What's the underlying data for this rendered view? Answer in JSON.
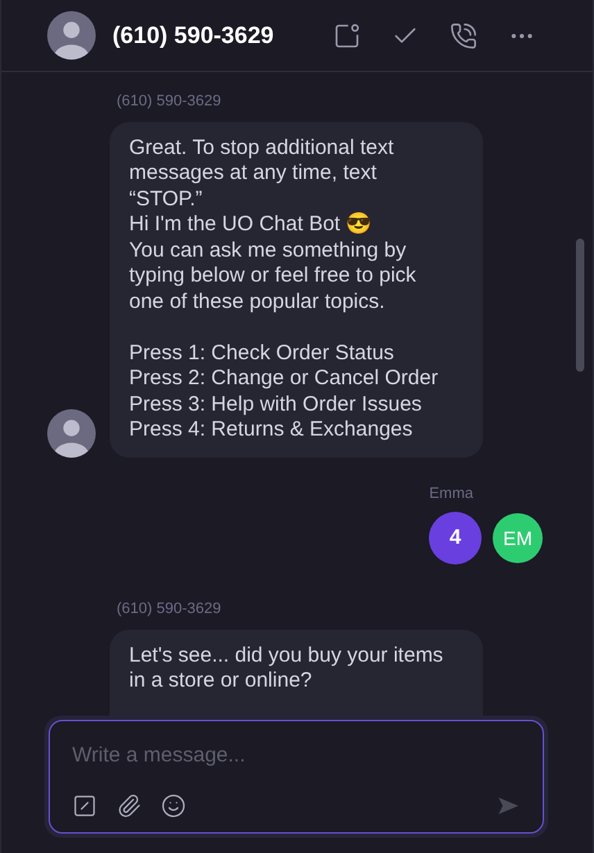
{
  "header": {
    "title": "(610) 590-3629"
  },
  "messages": [
    {
      "kind": "incoming",
      "sender": "(610) 590-3629",
      "text": "Great. To stop additional text messages at any time, text “STOP.”\nHi I'm the UO Chat Bot 😎\nYou can ask me something by typing below or feel free to pick one of these popular topics.\n\nPress 1: Check Order Status\nPress 2: Change or Cancel Order\nPress 3: Help with Order Issues\nPress 4: Returns & Exchanges",
      "avatar": true
    },
    {
      "kind": "outgoing",
      "sender": "Emma",
      "text": "4",
      "initials": "EM",
      "color": "#2ecc71"
    },
    {
      "kind": "incoming",
      "sender": "(610) 590-3629",
      "text": "Let's see... did you buy your items in a store or online?",
      "avatar": false
    }
  ],
  "composer": {
    "placeholder": "Write a message..."
  }
}
